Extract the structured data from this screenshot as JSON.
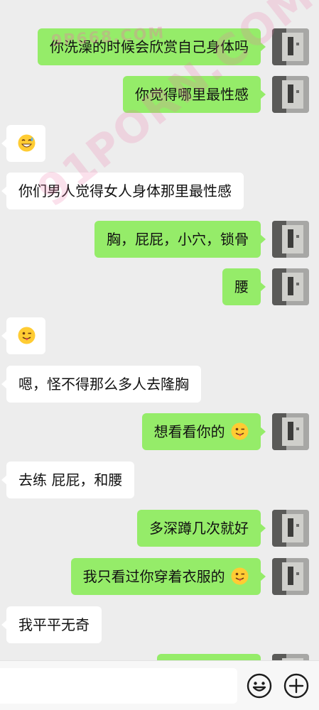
{
  "watermark": {
    "top_text": "9P668.COM",
    "diagonal_text": "91PORN.COM"
  },
  "messages": [
    {
      "side": "me",
      "text": "你洗澡的时候会欣赏自己身体吗",
      "emoji": ""
    },
    {
      "side": "me",
      "text": "你觉得哪里最性感",
      "emoji": ""
    },
    {
      "side": "them",
      "text": "",
      "emoji": "grinning-sweat-emoji"
    },
    {
      "side": "them",
      "text": "你们男人觉得女人身体那里最性感",
      "emoji": ""
    },
    {
      "side": "me",
      "text": "胸，屁屁，小穴，锁骨",
      "emoji": ""
    },
    {
      "side": "me",
      "text": "腰",
      "emoji": ""
    },
    {
      "side": "them",
      "text": "",
      "emoji": "winking-tongue-emoji"
    },
    {
      "side": "them",
      "text": "嗯，怪不得那么多人去隆胸",
      "emoji": ""
    },
    {
      "side": "me",
      "text": "想看看你的",
      "emoji": "winking-tongue-emoji"
    },
    {
      "side": "them",
      "text": "去练 屁屁，和腰",
      "emoji": ""
    },
    {
      "side": "me",
      "text": "多深蹲几次就好",
      "emoji": ""
    },
    {
      "side": "me",
      "text": "我只看过你穿着衣服的",
      "emoji": "winking-tongue-emoji"
    },
    {
      "side": "them",
      "text": "我平平无奇",
      "emoji": ""
    },
    {
      "side": "me",
      "text": "",
      "emoji": ""
    }
  ],
  "input_bar": {
    "placeholder": "",
    "value": "",
    "emoji_button_icon": "smiley-face-icon",
    "add_button_icon": "plus-circle-icon"
  },
  "colors": {
    "background": "#ededed",
    "my_bubble": "#95ec69",
    "their_bubble": "#ffffff",
    "input_bar": "#f7f7f7"
  }
}
